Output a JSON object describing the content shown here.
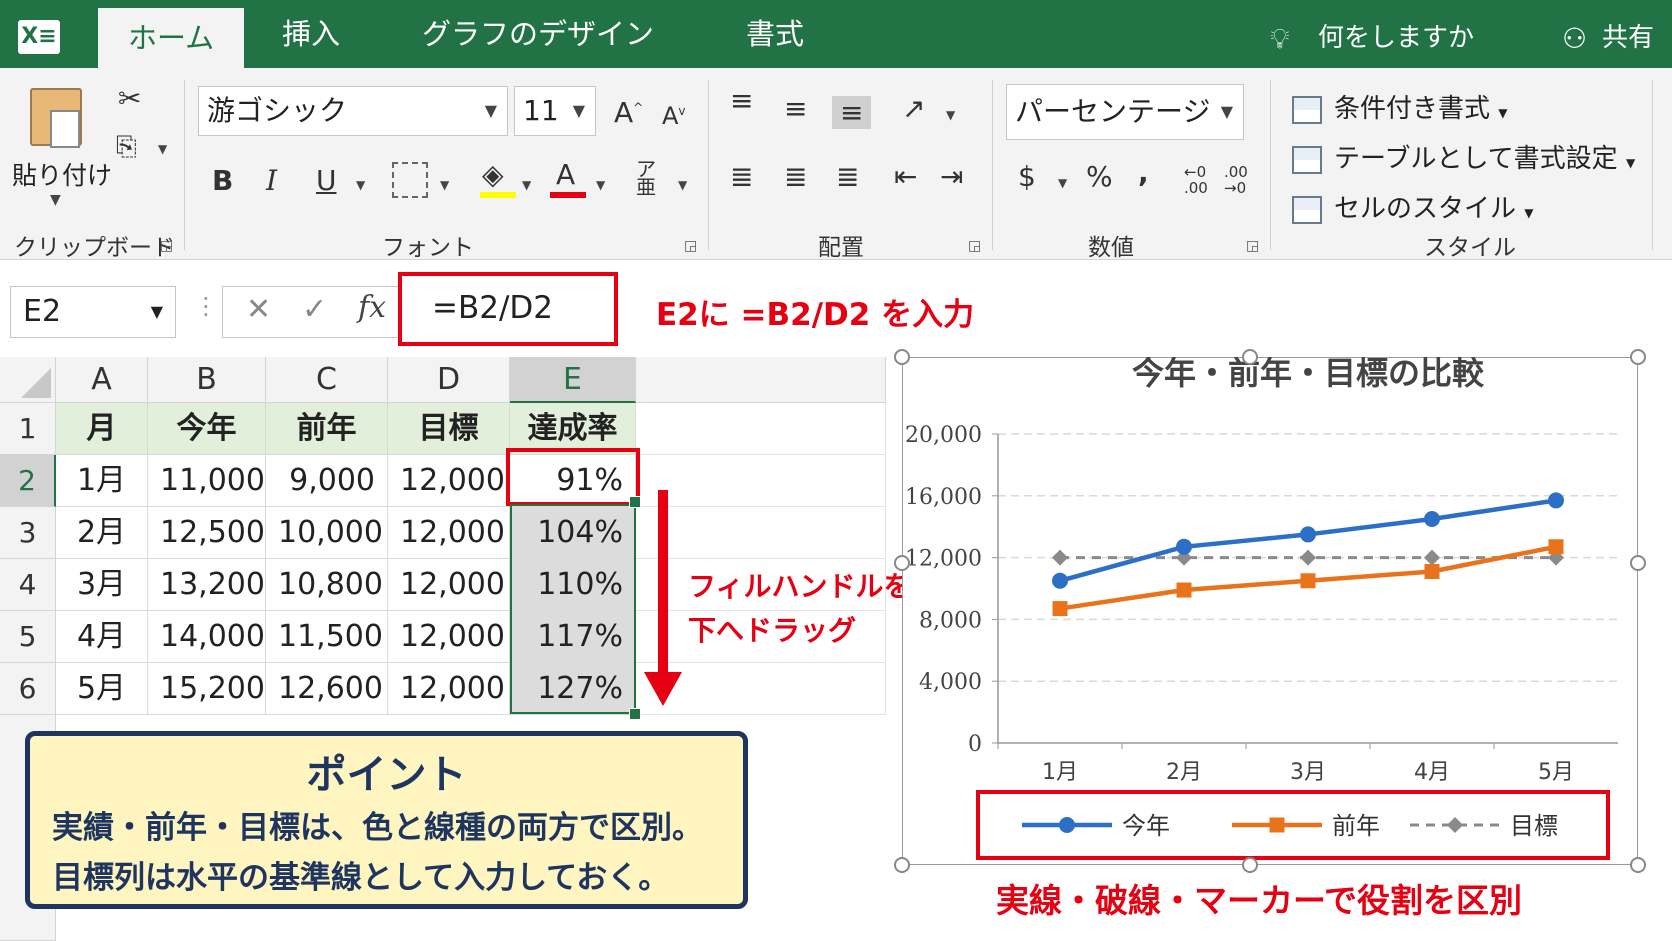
{
  "app": {
    "logo_text": "X≡"
  },
  "tabs": [
    {
      "label": "ホーム",
      "active": true
    },
    {
      "label": "挿入"
    },
    {
      "label": "グラフのデザイン"
    },
    {
      "label": "書式"
    }
  ],
  "tell_me": "何をしますか",
  "share": "共有",
  "ribbon": {
    "clipboard": {
      "paste": "貼り付け",
      "group": "クリップボード"
    },
    "font": {
      "name": "游ゴシック",
      "size": "11",
      "bold": "B",
      "italic": "I",
      "underline": "U",
      "group": "フォント",
      "grow": "A",
      "shrink": "A",
      "color_a": "A"
    },
    "alignment": {
      "group": "配置"
    },
    "number": {
      "format": "パーセンテージ",
      "currency": "$",
      "percent": "%",
      "comma": ",",
      "group": "数値",
      "inc": "←0 .00",
      "dec": ".00 →0"
    },
    "styles": {
      "conditional": "条件付き書式",
      "table": "テーブルとして書式設定",
      "cell": "セルのスタイル",
      "group": "スタイル"
    }
  },
  "formula_bar": {
    "name_box": "E2",
    "formula": "=B2/D2",
    "note": "E2に =B2/D2 を入力"
  },
  "sheet": {
    "columns": [
      "A",
      "B",
      "C",
      "D",
      "E"
    ],
    "rows": [
      "1",
      "2",
      "3",
      "4",
      "5",
      "6"
    ],
    "header": [
      "月",
      "今年",
      "前年",
      "目標",
      "達成率"
    ],
    "data": [
      [
        "1月",
        "11,000",
        "9,000",
        "12,000",
        "91%"
      ],
      [
        "2月",
        "12,500",
        "10,000",
        "12,000",
        "104%"
      ],
      [
        "3月",
        "13,200",
        "10,800",
        "12,000",
        "110%"
      ],
      [
        "4月",
        "14,000",
        "11,500",
        "12,000",
        "117%"
      ],
      [
        "5月",
        "15,200",
        "12,600",
        "12,000",
        "127%"
      ]
    ]
  },
  "fill_note": [
    "フィルハンドルを",
    "下へドラッグ"
  ],
  "point": {
    "title": "ポイント",
    "lines": [
      "実績・前年・目標は、色と線種の両方で区別。",
      "目標列は水平の基準線として入力しておく。"
    ]
  },
  "chart_note": "実線・破線・マーカーで役割を区別",
  "chart_data": {
    "type": "line",
    "title": "今年・前年・目標の比較",
    "categories": [
      "1月",
      "2月",
      "3月",
      "4月",
      "5月"
    ],
    "yticks": [
      "0",
      "4,000",
      "8,000",
      "12,000",
      "16,000",
      "20,000"
    ],
    "ylim": [
      0,
      20000
    ],
    "grid": true,
    "legend_position": "bottom",
    "series": [
      {
        "name": "今年",
        "values": [
          10500,
          12700,
          13500,
          14500,
          15700
        ],
        "color": "#2c6fc7",
        "style": "solid",
        "marker": "circle"
      },
      {
        "name": "前年",
        "values": [
          8700,
          9900,
          10500,
          11100,
          12700
        ],
        "color": "#e8731a",
        "style": "solid",
        "marker": "square"
      },
      {
        "name": "目標",
        "values": [
          12000,
          12000,
          12000,
          12000,
          12000
        ],
        "color": "#8a8a8a",
        "style": "dashed",
        "marker": "diamond"
      }
    ]
  }
}
